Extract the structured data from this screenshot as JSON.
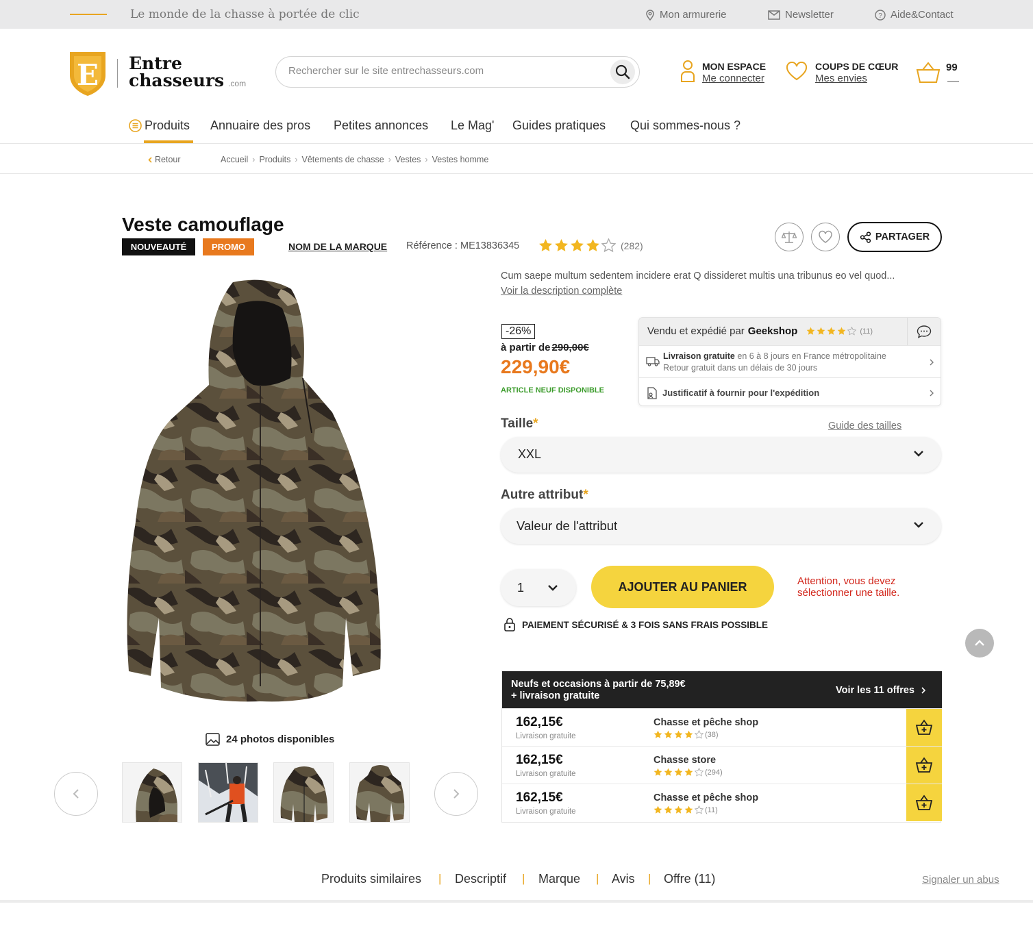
{
  "topbar": {
    "tagline": "Le monde de la chasse à portée de clic",
    "links": [
      {
        "label": "Mon armurerie",
        "icon": "location-pin-icon"
      },
      {
        "label": "Newsletter",
        "icon": "envelope-icon"
      },
      {
        "label": "Aide&Contact",
        "icon": "help-circle-icon"
      }
    ]
  },
  "brand": {
    "line1": "Entre",
    "line2": "chasseurs",
    "suffix": ".com",
    "logo_letter": "E",
    "accent": "#e8a520"
  },
  "search": {
    "placeholder": "Rechercher sur le site entrechasseurs.com"
  },
  "account": {
    "title": "MON ESPACE",
    "link": "Me connecter"
  },
  "wishlist": {
    "title": "COUPS DE CŒUR",
    "link": "Mes envies"
  },
  "cart": {
    "count": "99"
  },
  "nav": [
    "Produits",
    "Annuaire des pros",
    "Petites annonces",
    "Le Mag'",
    "Guides pratiques",
    "Qui sommes-nous ?"
  ],
  "breadcrumb": {
    "back": "Retour",
    "items": [
      "Accueil",
      "Produits",
      "Vêtements de chasse",
      "Vestes",
      "Vestes homme"
    ]
  },
  "product": {
    "title": "Veste camouflage",
    "badge_new": "NOUVEAUTÉ",
    "badge_promo": "PROMO",
    "brand": "NOM DE LA MARQUE",
    "reference": "Référence : ME13836345",
    "rating": 4,
    "reviews": "(282)",
    "share": "PARTAGER",
    "description": "Cum saepe multum sedentem incidere erat Q dissideret multis una tribunus eo vel quod...",
    "description_link": "Voir la description complète",
    "discount": "-26%",
    "from_prefix": "à partir de",
    "old_price": "290,00€",
    "price": "229,90€",
    "availability": "ARTICLE NEUF DISPONIBLE",
    "photos": "24 photos disponibles"
  },
  "seller": {
    "prefix": "Vendu et expédié par",
    "name": "Geekshop",
    "rating": 4,
    "reviews": "(11)",
    "delivery_bold": "Livraison gratuite",
    "delivery_rest": " en 6 à 8 jours en France métropolitaine",
    "return": "Retour gratuit dans un délais de 30 jours",
    "proof": "Justificatif à fournir pour l'expédition"
  },
  "size": {
    "label": "Taille",
    "guide": "Guide des tailles",
    "value": "XXL"
  },
  "attribute": {
    "label": "Autre attribut",
    "value": "Valeur de l'attribut"
  },
  "quantity": {
    "value": "1"
  },
  "add_to_cart": "AJOUTER AU PANIER",
  "warning": {
    "line1": "Attention, vous devez",
    "line2": "sélectionner une taille."
  },
  "secure_payment": "PAIEMENT SÉCURISÉ & 3 FOIS SANS FRAIS POSSIBLE",
  "offers": {
    "head_line1": "Neufs et occasions à partir de 75,89€",
    "head_line2": "+ livraison gratuite",
    "see_all": "Voir les 11 offres",
    "rows": [
      {
        "price": "162,15€",
        "shipping": "Livraison gratuite",
        "shop": "Chasse et pêche shop",
        "rating": 4,
        "reviews": "(38)"
      },
      {
        "price": "162,15€",
        "shipping": "Livraison gratuite",
        "shop": "Chasse store",
        "rating": 4,
        "reviews": "(294)"
      },
      {
        "price": "162,15€",
        "shipping": "Livraison gratuite",
        "shop": "Chasse et pêche shop",
        "rating": 4,
        "reviews": "(11)"
      }
    ]
  },
  "tabs": [
    "Produits similaires",
    "Descriptif",
    "Marque",
    "Avis",
    "Offre (11)"
  ],
  "report": "Signaler un abus",
  "colors": {
    "accent": "#e8a520",
    "price": "#e8791e",
    "promo": "#e8791e",
    "cta": "#f5d43e",
    "warning": "#d2261b",
    "available": "#3c9c2c"
  }
}
